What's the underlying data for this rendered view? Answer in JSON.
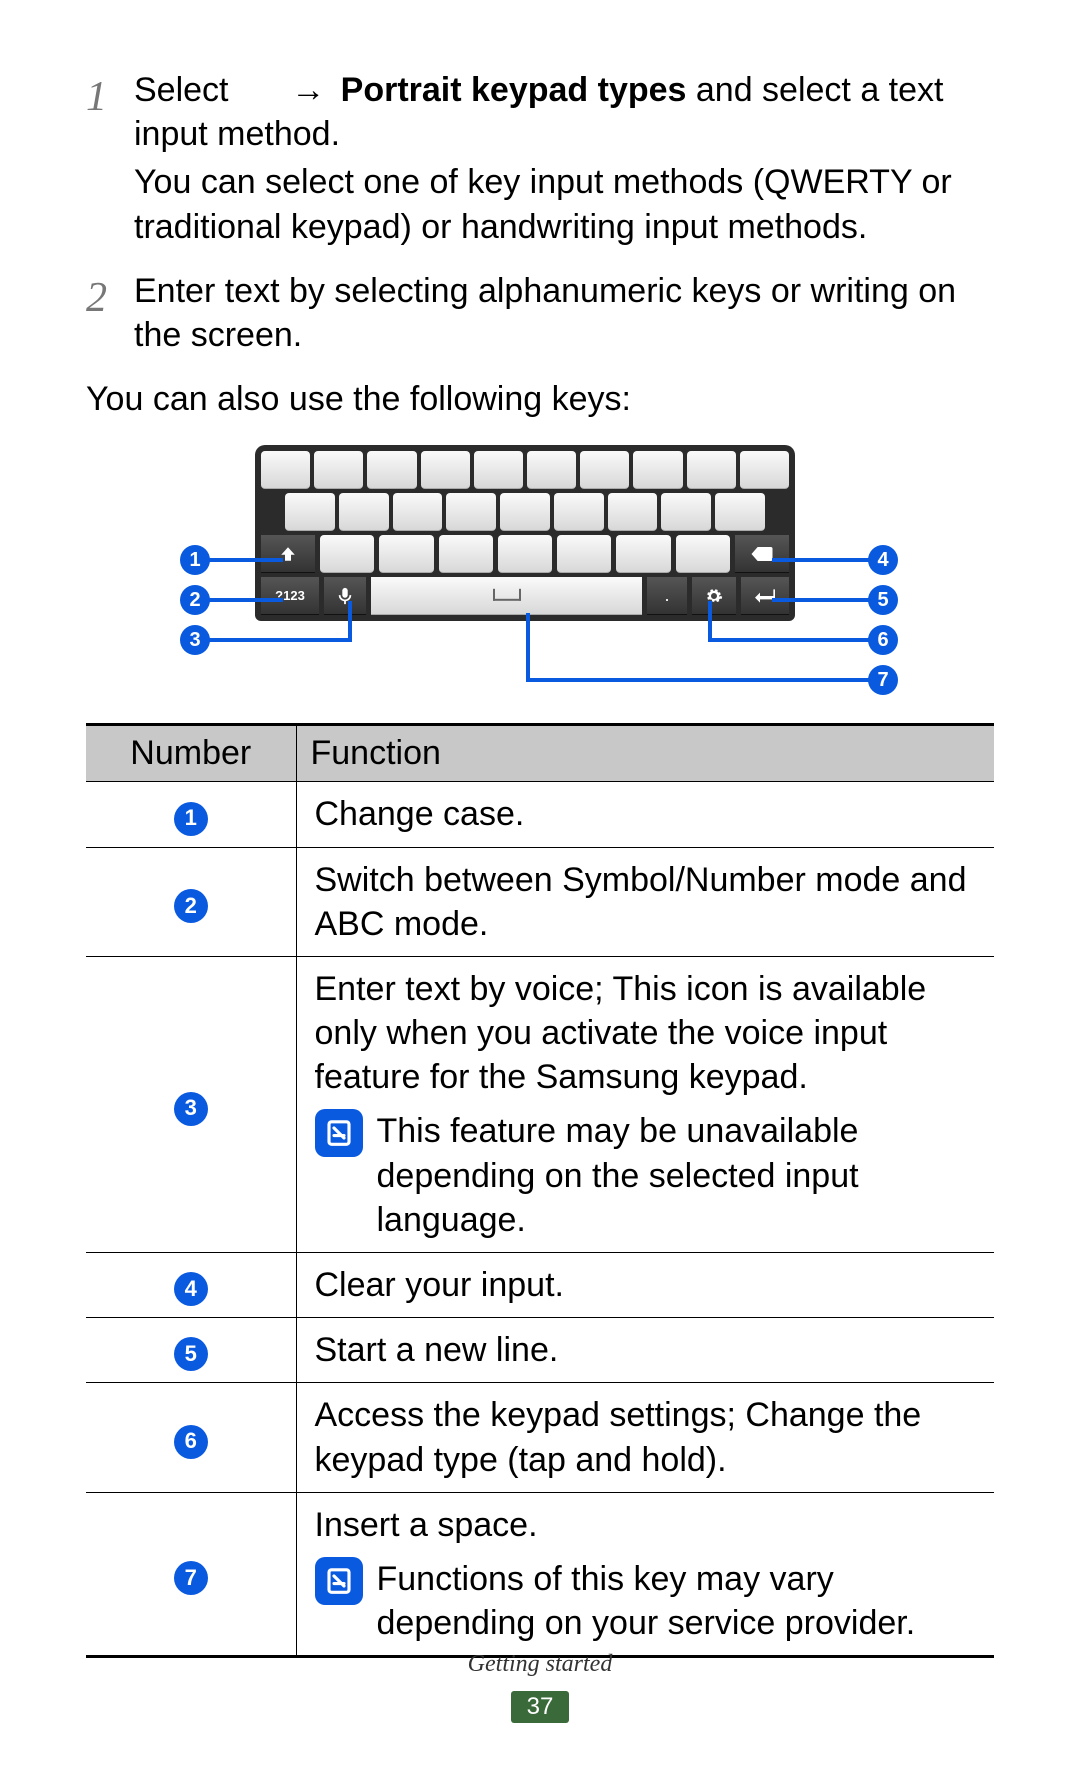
{
  "steps": [
    {
      "num": "1",
      "lead": "Select",
      "arrow": "→",
      "bold": "Portrait keypad types",
      "tail": " and select a text input method.",
      "detail": "You can select one of key input methods (QWERTY or traditional keypad) or handwriting input methods."
    },
    {
      "num": "2",
      "text": "Enter text by selecting alphanumeric keys or writing on the screen."
    }
  ],
  "intro": "You can also use the following keys:",
  "callouts": {
    "1": "1",
    "2": "2",
    "3": "3",
    "4": "4",
    "5": "5",
    "6": "6",
    "7": "7"
  },
  "key_labels": {
    "sym": "?123",
    "dot": "."
  },
  "table": {
    "headers": {
      "number": "Number",
      "function": "Function"
    },
    "rows": [
      {
        "n": "1",
        "text": "Change case."
      },
      {
        "n": "2",
        "text": "Switch between Symbol/Number mode and ABC mode."
      },
      {
        "n": "3",
        "text": "Enter text by voice; This icon is available only when you activate the voice input feature for the Samsung keypad.",
        "note": "This feature may be unavailable depending on the selected input language."
      },
      {
        "n": "4",
        "text": "Clear your input."
      },
      {
        "n": "5",
        "text": "Start a new line."
      },
      {
        "n": "6",
        "text": "Access the keypad settings; Change the keypad type (tap and hold)."
      },
      {
        "n": "7",
        "text": "Insert a space.",
        "note": "Functions of this key may vary depending on your service provider."
      }
    ]
  },
  "footer": {
    "section": "Getting started",
    "page": "37"
  }
}
